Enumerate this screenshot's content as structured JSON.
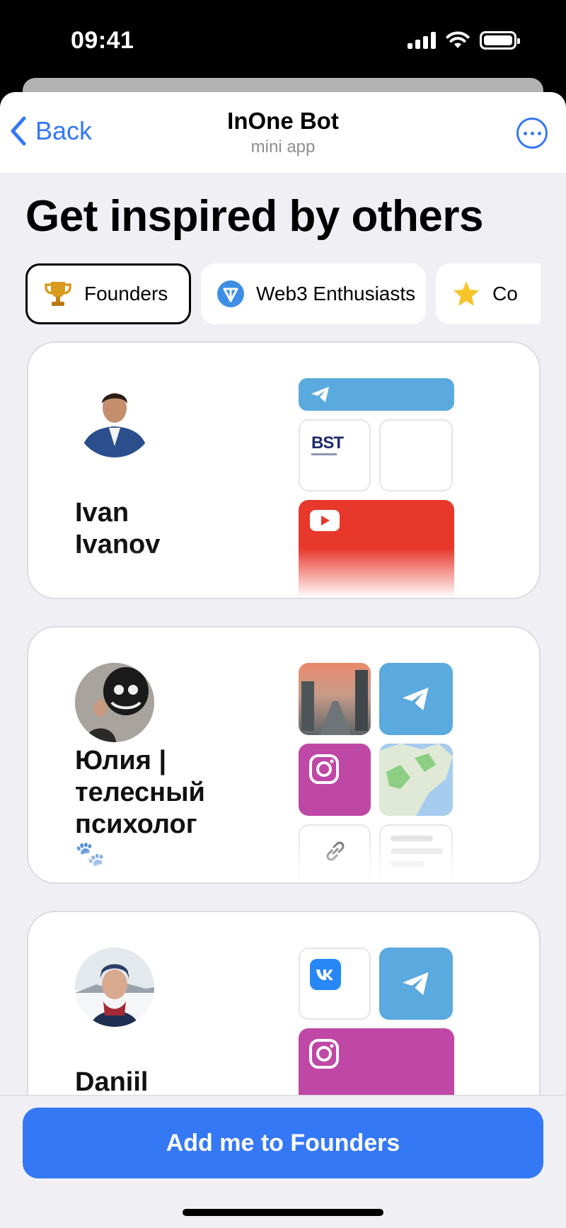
{
  "status_bar": {
    "time": "09:41"
  },
  "navbar": {
    "back_label": "Back",
    "title": "InOne Bot",
    "subtitle": "mini app"
  },
  "page": {
    "heading": "Get inspired by others"
  },
  "chips": [
    {
      "label": "Founders",
      "icon": "trophy-icon",
      "active": true
    },
    {
      "label": "Web3 Enthusiasts",
      "icon": "ton-diamond-icon",
      "active": false
    },
    {
      "label": "Co",
      "icon": "star-icon",
      "active": false
    }
  ],
  "profiles": [
    {
      "name": "Ivan Ivanov",
      "name_lines": [
        "Ivan",
        "Ivanov"
      ],
      "tiles": [
        "telegram",
        "bst-digital",
        "blank",
        "youtube"
      ],
      "bst_text": "BST"
    },
    {
      "name": "Юлия | телесный психолог 🐾",
      "name_lines": [
        "Юлия |",
        "телесный",
        "психолог"
      ],
      "paw": "🐾",
      "tiles": [
        "photo",
        "telegram",
        "instagram",
        "map",
        "link",
        "text"
      ]
    },
    {
      "name": "Daniil",
      "name_lines": [
        "Daniil"
      ],
      "tiles": [
        "vk",
        "telegram",
        "instagram"
      ]
    }
  ],
  "cta": {
    "label": "Add me to Founders"
  },
  "colors": {
    "accent": "#3478f6",
    "telegram": "#5aa9df",
    "instagram": "#bf47a6",
    "youtube": "#e8372b",
    "background": "#efeff4"
  }
}
